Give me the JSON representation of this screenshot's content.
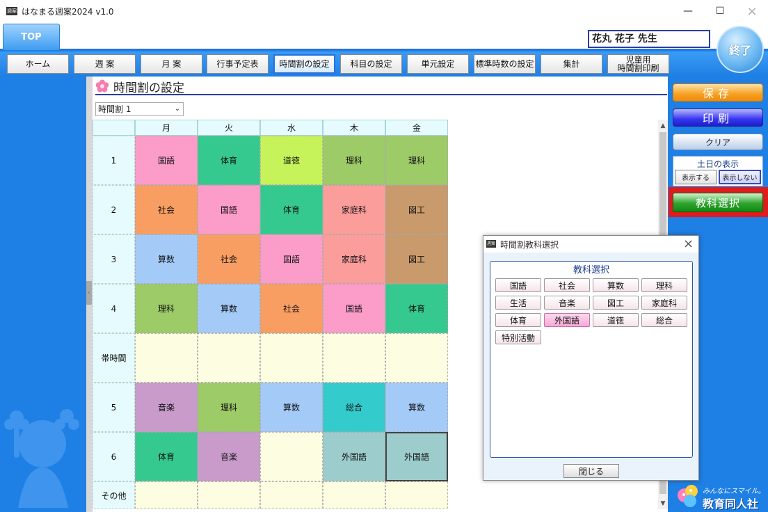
{
  "window": {
    "title": "はなまる週案2024 v1.0",
    "icon_text": "週案"
  },
  "top": {
    "tab_label": "TOP",
    "teacher": "花丸 花子 先生",
    "exit_label": "終了"
  },
  "nav": [
    "ホーム",
    "週 案",
    "月 案",
    "行事予定表",
    "時間割の設定",
    "科目の設定",
    "単元設定",
    "標準時数の設定",
    "集計",
    "児童用\n時間割印刷"
  ],
  "page": {
    "title": "時間割の設定",
    "selector_value": "時間割 1"
  },
  "grid": {
    "days": [
      "月",
      "火",
      "水",
      "木",
      "金"
    ],
    "periods": [
      "1",
      "2",
      "3",
      "4",
      "帯時間",
      "5",
      "6",
      "その他"
    ],
    "cells": [
      [
        "国語",
        "体育",
        "道徳",
        "理科",
        "理科"
      ],
      [
        "社会",
        "国語",
        "体育",
        "家庭科",
        "図工"
      ],
      [
        "算数",
        "社会",
        "国語",
        "家庭科",
        "図工"
      ],
      [
        "理科",
        "算数",
        "社会",
        "国語",
        "体育"
      ],
      [
        "",
        "",
        "",
        "",
        ""
      ],
      [
        "音楽",
        "理科",
        "算数",
        "総合",
        "算数"
      ],
      [
        "体育",
        "音楽",
        "",
        "外国語",
        "外国語"
      ],
      [
        "",
        "",
        "",
        "",
        ""
      ]
    ]
  },
  "subject_colors": {
    "国語": "#fb9cc9",
    "体育": "#36c98f",
    "道徳": "#c6f35a",
    "理科": "#9dcb68",
    "社会": "#f99e62",
    "家庭科": "#fb9d9b",
    "図工": "#c99a6b",
    "算数": "#a4cbf8",
    "音楽": "#c89bcb",
    "総合": "#33cbcc",
    "外国語": "#9ccccc",
    "": "#fdfde2"
  },
  "right_panel": {
    "save_label": "保存",
    "print_label": "印刷",
    "clear_label": "クリア",
    "weekend_title": "土日の表示",
    "weekend_show": "表示する",
    "weekend_hide": "表示しない",
    "subject_select_label": "教科選択",
    "logo_tagline": "みんなにスマイル。",
    "logo_name": "教育同人社"
  },
  "dialog": {
    "title": "時間割教科選択",
    "group_title": "教科選択",
    "subjects": [
      "国語",
      "社会",
      "算数",
      "理科",
      "生活",
      "音楽",
      "図工",
      "家庭科",
      "体育",
      "外国語",
      "道徳",
      "総合",
      "特別活動"
    ],
    "highlighted": "外国語",
    "close_label": "閉じる"
  }
}
